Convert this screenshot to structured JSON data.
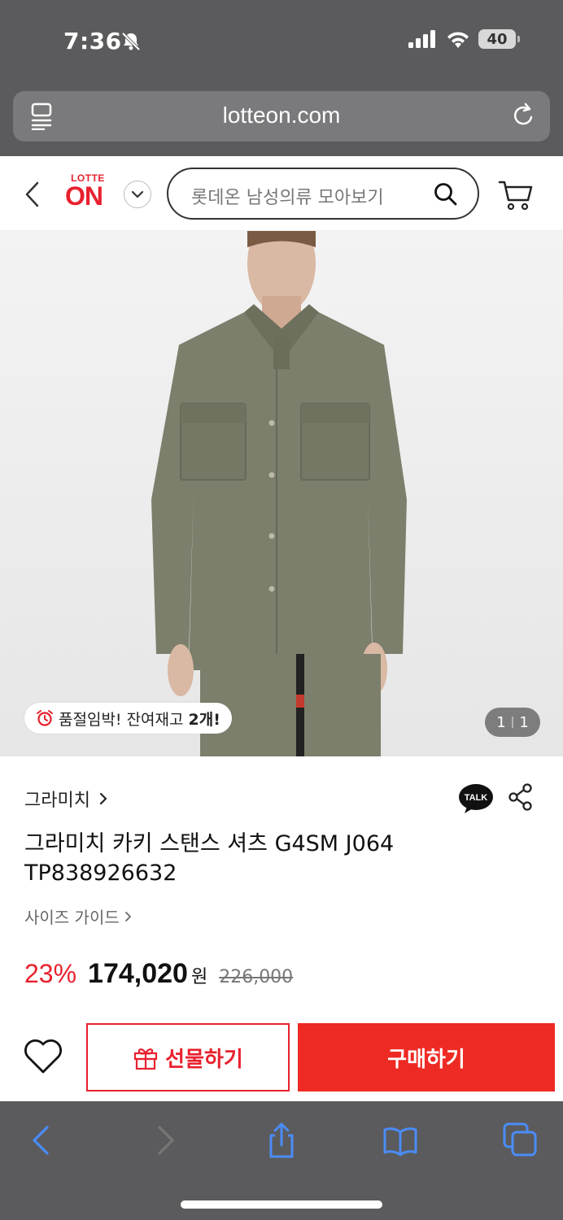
{
  "status_bar": {
    "time": "7:36",
    "battery": "40"
  },
  "browser": {
    "url": "lotteon.com"
  },
  "header": {
    "logo_top": "LOTTE",
    "logo_main": "ON",
    "search_placeholder": "롯데온 남성의류 모아보기"
  },
  "image": {
    "stock_prefix": "품절임박! 잔여재고 ",
    "stock_count": "2개!",
    "counter_current": "1",
    "counter_sep": "|",
    "counter_total": "1"
  },
  "product": {
    "brand": "그라미치",
    "title": "그라미치 카키 스탠스 셔츠 G4SM J064 TP838926632",
    "size_guide": "사이즈 가이드",
    "discount": "23%",
    "price": "174,020",
    "currency": "원",
    "original_price": "226,000"
  },
  "actions": {
    "gift_label": "선물하기",
    "buy_label": "구매하기"
  },
  "colors": {
    "accent": "#e8212e",
    "buy_button": "#ee2a24",
    "chrome": "#5b5b5d",
    "toolbar_icon": "#4a8cf7"
  }
}
